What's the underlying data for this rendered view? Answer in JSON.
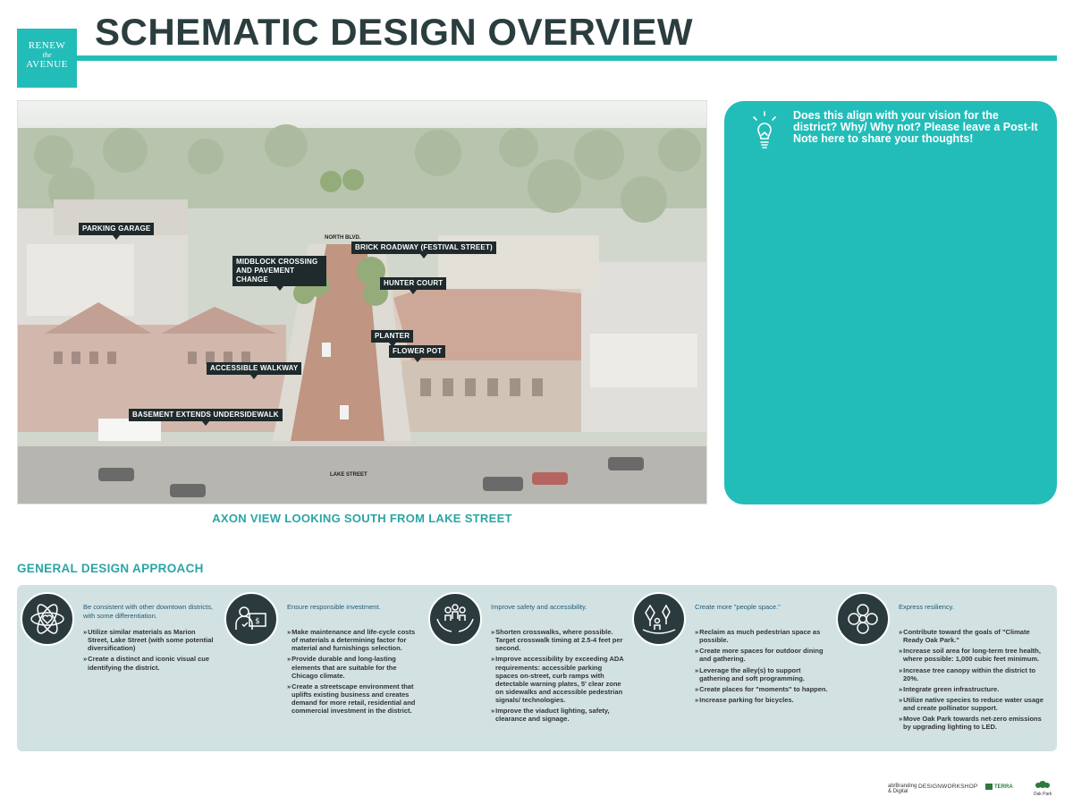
{
  "logo": {
    "line1": "RENEW",
    "line2": "the",
    "line3": "AVENUE"
  },
  "title": "SCHEMATIC DESIGN OVERVIEW",
  "photo": {
    "callouts": [
      "PARKING GARAGE",
      "MIDBLOCK CROSSING AND PAVEMENT CHANGE",
      "BRICK ROADWAY (FESTIVAL STREET)",
      "HUNTER COURT",
      "PLANTER",
      "FLOWER POT",
      "ACCESSIBLE WALKWAY",
      "BASEMENT EXTENDS UNDERSIDEWALK"
    ],
    "street_labels": [
      "NORTH BLVD.",
      "LAKE STREET"
    ]
  },
  "caption": "AXON VIEW LOOKING SOUTH FROM LAKE STREET",
  "note": {
    "prompt": "Does this align with your vision for the district? Why/ Why not? Please leave a Post-It Note here to share your thoughts!"
  },
  "section_title": "GENERAL DESIGN APPROACH",
  "approach": [
    {
      "icon": "atom-heart-icon",
      "heading": "Be consistent with other downtown districts, with some differentiation.",
      "items": [
        "Utilize similar materials as Marion Street, Lake Street (with some potential diversification)",
        "Create a distinct and iconic visual cue identifying the district."
      ]
    },
    {
      "icon": "person-investment-icon",
      "heading": "Ensure responsible investment.",
      "items": [
        "Make maintenance and life-cycle costs of materials a determining factor for material and furnishings selection.",
        "Provide durable and long-lasting elements that are suitable for the Chicago climate.",
        "Create a streetscape environment that uplifts existing business and creates demand for more retail, residential and commercial investment in the district."
      ]
    },
    {
      "icon": "hands-people-icon",
      "heading": "Improve safety and accessibility.",
      "items": [
        "Shorten crosswalks, where possible. Target crosswalk timing at 2.5-4 feet per second.",
        "Improve accessibility by exceeding ADA requirements: accessible parking spaces on-street, curb ramps with detectable warning plates, 5' clear zone on sidewalks and accessible pedestrian signals/ technologies.",
        "Improve the viaduct lighting, safety, clearance and signage."
      ]
    },
    {
      "icon": "trees-people-icon",
      "heading": "Create more \"people space.\"",
      "items": [
        "Reclaim as much pedestrian space as possible.",
        "Create more spaces for outdoor dining and gathering.",
        "Leverage the alley(s) to support gathering and soft programming.",
        "Create places for \"moments\" to happen.",
        "Increase parking for bicycles."
      ]
    },
    {
      "icon": "flower-icon",
      "heading": "Express resiliency.",
      "items": [
        "Contribute toward the goals of \"Climate Ready Oak Park.\"",
        "Increase soil area for long-term tree health, where possible: 1,000 cubic feet minimum.",
        "Increase tree canopy within the district to 20%.",
        "Integrate green infrastructure.",
        "Utilize native species to reduce water usage and create pollinator support.",
        "Move Oak Park towards net-zero emissions by upgrading lighting to LED."
      ]
    }
  ],
  "footer": {
    "logo1": "ab/Branding & Digital",
    "logo2": "DESIGNWORKSHOP",
    "logo3": "TERRA",
    "logo4": "Oak Park"
  },
  "colors": {
    "accent": "#23bdb9",
    "dark": "#2b3d3f",
    "panel": "#d2e2e3",
    "link": "#2aa5a4"
  }
}
